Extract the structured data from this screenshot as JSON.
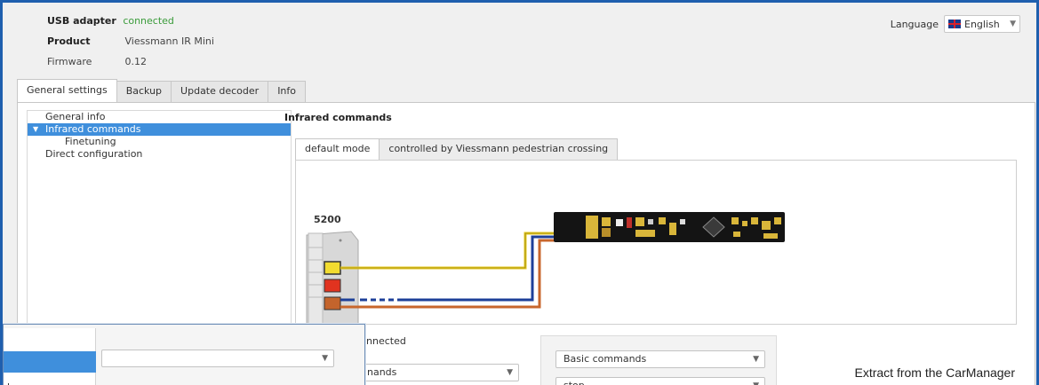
{
  "header": {
    "usb_label": "USB adapter",
    "usb_status": "connected",
    "product_label": "Product",
    "product_value": "Viessmann IR Mini",
    "firmware_label": "Firmware",
    "firmware_value": "0.12"
  },
  "language": {
    "label": "Language",
    "selected": "English",
    "flag_icon": "uk-flag-icon"
  },
  "tabs": [
    {
      "label": "General settings",
      "active": true
    },
    {
      "label": "Backup",
      "active": false
    },
    {
      "label": "Update decoder",
      "active": false
    },
    {
      "label": "Info",
      "active": false
    }
  ],
  "tree": {
    "items": [
      {
        "label": "General info"
      },
      {
        "label": "Infrared commands",
        "selected": true
      },
      {
        "label": "Finetuning"
      },
      {
        "label": "Direct configuration"
      }
    ]
  },
  "section": {
    "title": "Infrared commands",
    "subtabs": [
      {
        "label": "default mode",
        "active": true
      },
      {
        "label": "controlled by Viessmann pedestrian crossing",
        "active": false
      }
    ],
    "device_number": "5200"
  },
  "bottom": {
    "group_a_label": "nnected",
    "combo_a": "nands",
    "combo_b1": "Basic commands",
    "combo_b2": "stop",
    "popup_item": "ds"
  },
  "colors": {
    "accent": "#3f8fdc",
    "frame": "#1f5fae",
    "status_green": "#3a9b3a",
    "wire_yellow": "#e4c81c",
    "wire_blue": "#1d3f98",
    "wire_orange": "#c8662c"
  },
  "credit": "Extract from the CarManager"
}
